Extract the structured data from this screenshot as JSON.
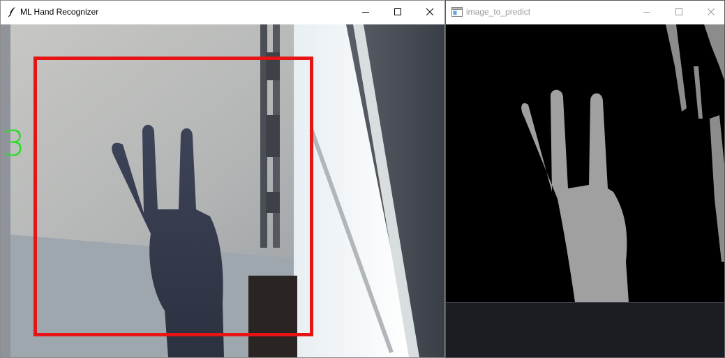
{
  "left_window": {
    "title": "ML Hand Recognizer",
    "icon": "feather-icon",
    "controls": [
      "minimize-icon",
      "maximize-icon",
      "close-icon"
    ],
    "prediction": "3",
    "prediction_color": "#1fe01f",
    "roi_color": "#e61414"
  },
  "right_window": {
    "title": "image_to_predict",
    "icon": "window-app-icon",
    "controls": [
      "minimize-icon",
      "maximize-icon",
      "close-icon"
    ],
    "mask_color": "#a0a0a0"
  }
}
